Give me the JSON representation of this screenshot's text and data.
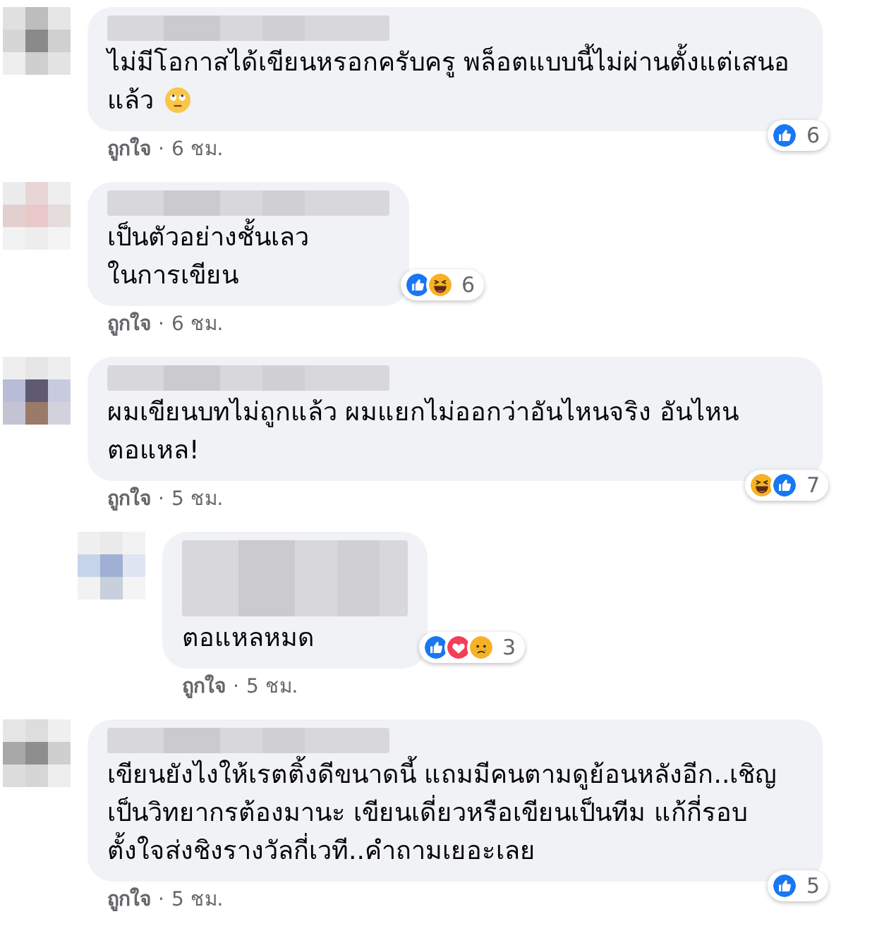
{
  "comments": [
    {
      "reply": false,
      "text": "ไม่มีโอกาสได้เขียนหรอกครับครู พล็อตแบบนี้ไม่ผ่านตั้งแต่เสนอแล้ว",
      "trailing_emoji": true,
      "reactions_beside": false,
      "reactions": [
        {
          "kind": "like"
        }
      ],
      "reaction_count": "6",
      "like_label": "ถูกใจ",
      "separator": "·",
      "time": "6 ชม."
    },
    {
      "reply": false,
      "text": "เป็นตัวอย่างชั้นเลว\nในการเขียน",
      "trailing_emoji": false,
      "reactions_beside": true,
      "reactions": [
        {
          "kind": "like"
        },
        {
          "kind": "haha"
        }
      ],
      "reaction_count": "6",
      "like_label": "ถูกใจ",
      "separator": "·",
      "time": "6 ชม."
    },
    {
      "reply": false,
      "text": "ผมเขียนบทไม่ถูกแล้ว ผมแยกไม่ออกว่าอันไหนจริง อันไหน\nตอแหล!",
      "trailing_emoji": false,
      "reactions_beside": false,
      "reactions": [
        {
          "kind": "haha"
        },
        {
          "kind": "like"
        }
      ],
      "reaction_count": "7",
      "like_label": "ถูกใจ",
      "separator": "·",
      "time": "5 ชม."
    },
    {
      "reply": true,
      "text": "ตอแหลหมด",
      "trailing_emoji": false,
      "reactions_beside": true,
      "reactions": [
        {
          "kind": "like"
        },
        {
          "kind": "love"
        },
        {
          "kind": "sad"
        }
      ],
      "reaction_count": "3",
      "like_label": "ถูกใจ",
      "separator": "·",
      "time": "5 ชม."
    },
    {
      "reply": false,
      "text": "เขียนยังไงให้เรตติ้งดีขนาดนี้ แถมมีคนตามดูย้อนหลังอีก..เชิญเป็นวิทยากรต้องมานะ เขียนเดี่ยวหรือเขียนเป็นทีม แก้กี่รอบตั้งใจส่งชิงรางวัลกี่เวที..คำถามเยอะเลย",
      "trailing_emoji": false,
      "reactions_beside": false,
      "reactions": [
        {
          "kind": "like"
        }
      ],
      "reaction_count": "5",
      "like_label": "ถูกใจ",
      "separator": "·",
      "time": "5 ชม."
    }
  ]
}
